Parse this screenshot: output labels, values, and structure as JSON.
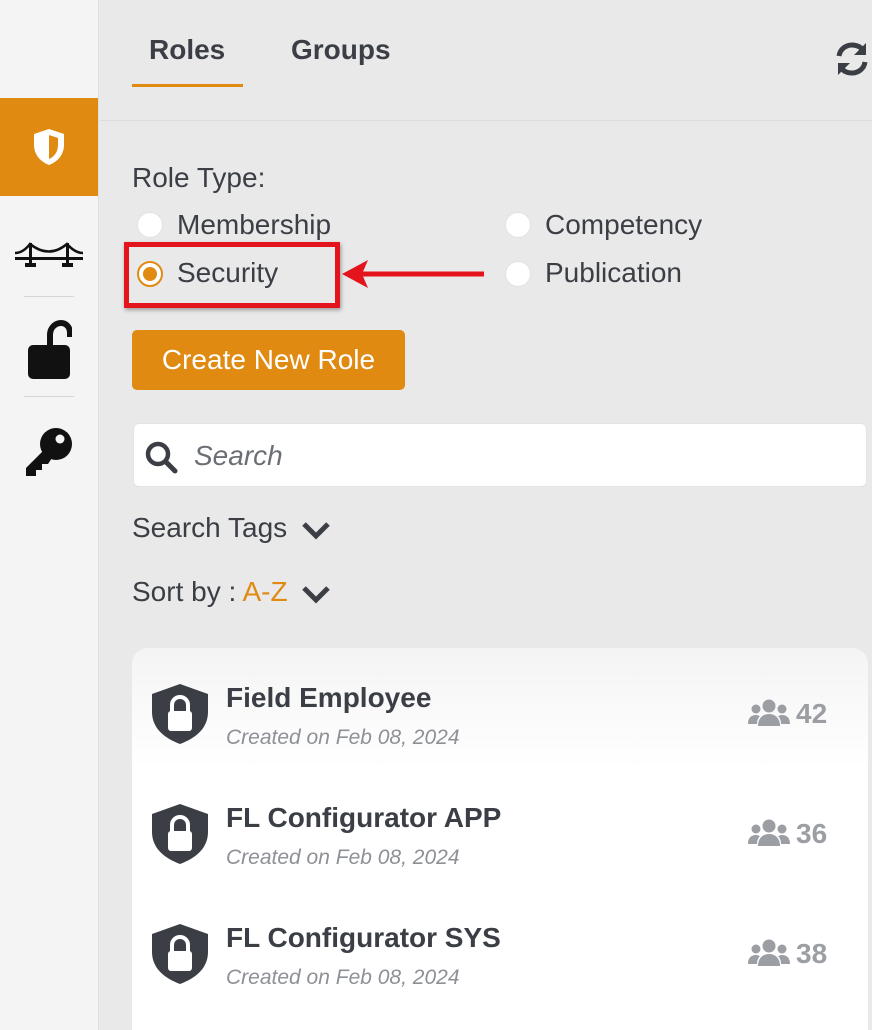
{
  "sidebar": {
    "items": [
      {
        "icon": "shield-icon",
        "active": true
      },
      {
        "icon": "bridge-icon",
        "active": false
      },
      {
        "icon": "unlock-icon",
        "active": false
      },
      {
        "icon": "key-icon",
        "active": false
      }
    ]
  },
  "tabs": [
    {
      "label": "Roles",
      "active": true
    },
    {
      "label": "Groups",
      "active": false
    }
  ],
  "header": {
    "refresh_icon": "refresh-icon"
  },
  "role_type": {
    "label": "Role Type:",
    "options": [
      {
        "label": "Membership",
        "selected": false
      },
      {
        "label": "Competency",
        "selected": false
      },
      {
        "label": "Security",
        "selected": true
      },
      {
        "label": "Publication",
        "selected": false
      }
    ]
  },
  "annotation": {
    "color": "#e3141b"
  },
  "create_button": {
    "label": "Create New Role"
  },
  "search": {
    "placeholder": "Search",
    "value": ""
  },
  "search_tags": {
    "label": "Search Tags"
  },
  "sort": {
    "label": "Sort by :",
    "value": "A-Z"
  },
  "roles": [
    {
      "name": "Field Employee",
      "created": "Created on Feb 08, 2024",
      "members": "42"
    },
    {
      "name": "FL Configurator APP",
      "created": "Created on Feb 08, 2024",
      "members": "36"
    },
    {
      "name": "FL Configurator SYS",
      "created": "Created on Feb 08, 2024",
      "members": "38"
    }
  ],
  "colors": {
    "accent": "#e08a12",
    "text": "#3b3f45",
    "muted": "#8d9096"
  }
}
